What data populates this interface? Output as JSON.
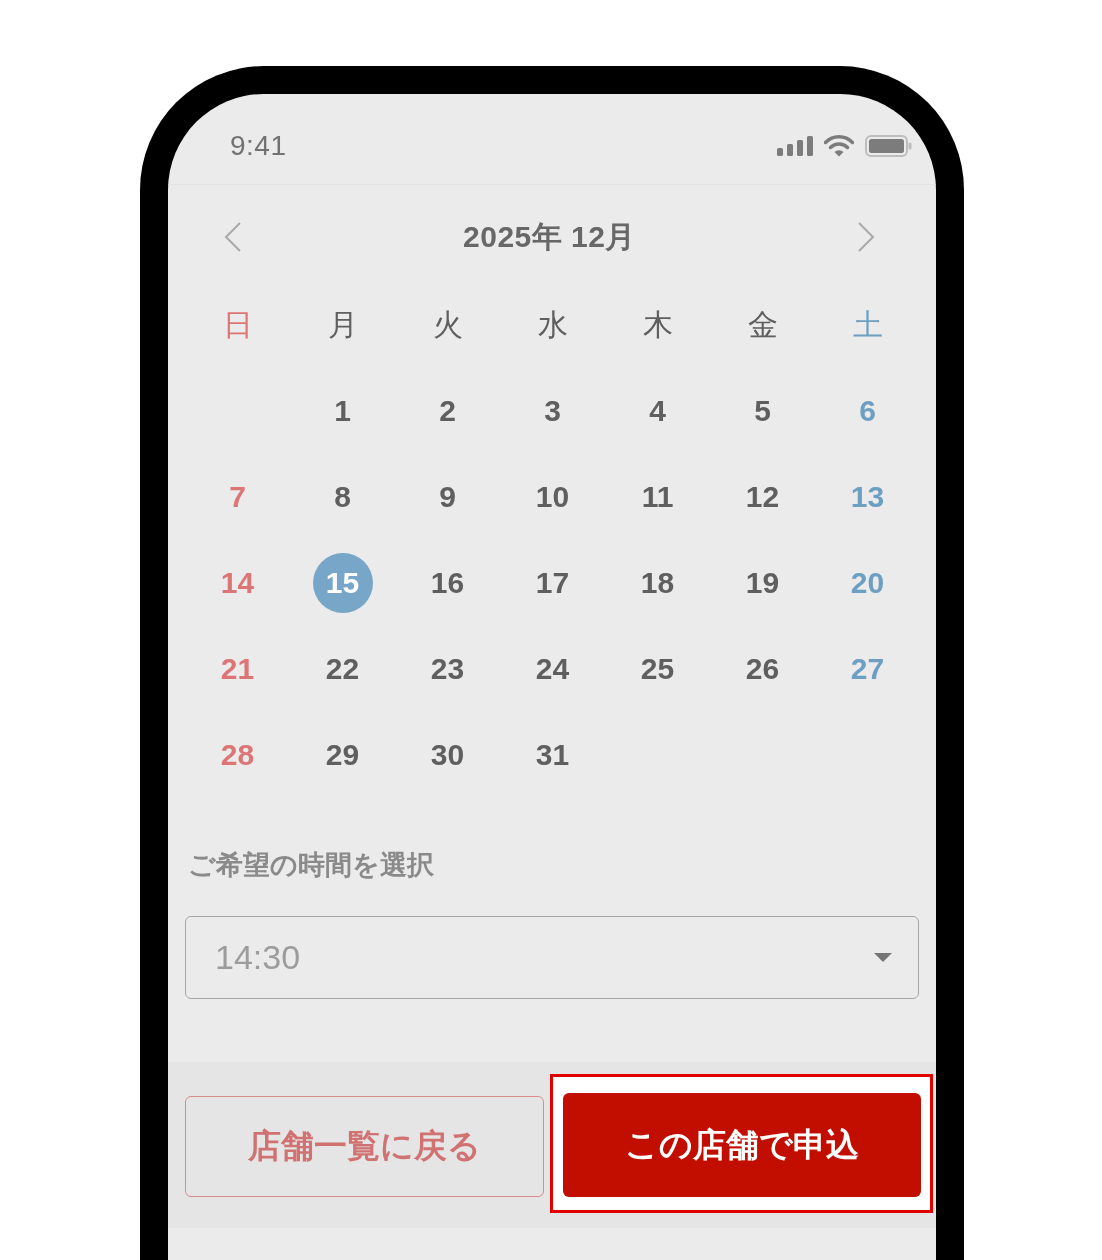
{
  "status_bar": {
    "time": "9:41"
  },
  "calendar": {
    "title": "2025年 12月",
    "weekdays": [
      {
        "label": "日",
        "color": "#dc7676"
      },
      {
        "label": "月",
        "color": "#5f5f5f"
      },
      {
        "label": "火",
        "color": "#5f5f5f"
      },
      {
        "label": "水",
        "color": "#5f5f5f"
      },
      {
        "label": "木",
        "color": "#5f5f5f"
      },
      {
        "label": "金",
        "color": "#5f5f5f"
      },
      {
        "label": "土",
        "color": "#6d9fc3"
      }
    ],
    "weeks": [
      [
        {
          "kind": "blank"
        },
        {
          "kind": "day",
          "label": "1",
          "selected": false
        },
        {
          "kind": "day",
          "label": "2",
          "selected": false
        },
        {
          "kind": "day",
          "label": "3",
          "selected": false
        },
        {
          "kind": "day",
          "label": "4",
          "selected": false
        },
        {
          "kind": "day",
          "label": "5",
          "selected": false
        },
        {
          "kind": "day",
          "label": "6",
          "selected": false
        }
      ],
      [
        {
          "kind": "day",
          "label": "7",
          "selected": false
        },
        {
          "kind": "day",
          "label": "8",
          "selected": false
        },
        {
          "kind": "day",
          "label": "9",
          "selected": false
        },
        {
          "kind": "day",
          "label": "10",
          "selected": false
        },
        {
          "kind": "day",
          "label": "11",
          "selected": false
        },
        {
          "kind": "day",
          "label": "12",
          "selected": false
        },
        {
          "kind": "day",
          "label": "13",
          "selected": false
        }
      ],
      [
        {
          "kind": "day",
          "label": "14",
          "selected": false
        },
        {
          "kind": "day",
          "label": "15",
          "selected": true
        },
        {
          "kind": "day",
          "label": "16",
          "selected": false
        },
        {
          "kind": "day",
          "label": "17",
          "selected": false
        },
        {
          "kind": "day",
          "label": "18",
          "selected": false
        },
        {
          "kind": "day",
          "label": "19",
          "selected": false
        },
        {
          "kind": "day",
          "label": "20",
          "selected": false
        }
      ],
      [
        {
          "kind": "day",
          "label": "21",
          "selected": false
        },
        {
          "kind": "day",
          "label": "22",
          "selected": false
        },
        {
          "kind": "day",
          "label": "23",
          "selected": false
        },
        {
          "kind": "day",
          "label": "24",
          "selected": false
        },
        {
          "kind": "day",
          "label": "25",
          "selected": false
        },
        {
          "kind": "day",
          "label": "26",
          "selected": false
        },
        {
          "kind": "day",
          "label": "27",
          "selected": false
        }
      ],
      [
        {
          "kind": "day",
          "label": "28",
          "selected": false
        },
        {
          "kind": "day",
          "label": "29",
          "selected": false
        },
        {
          "kind": "day",
          "label": "30",
          "selected": false
        },
        {
          "kind": "day",
          "label": "31",
          "selected": false
        }
      ]
    ]
  },
  "time_select": {
    "label": "ご希望の時間を選択",
    "value": "14:30"
  },
  "buttons": [
    {
      "kind": "secondary",
      "label": "店舗一覧に戻る",
      "highlighted": false
    },
    {
      "kind": "primary",
      "label": "この店舗で申込",
      "highlighted": true
    }
  ]
}
